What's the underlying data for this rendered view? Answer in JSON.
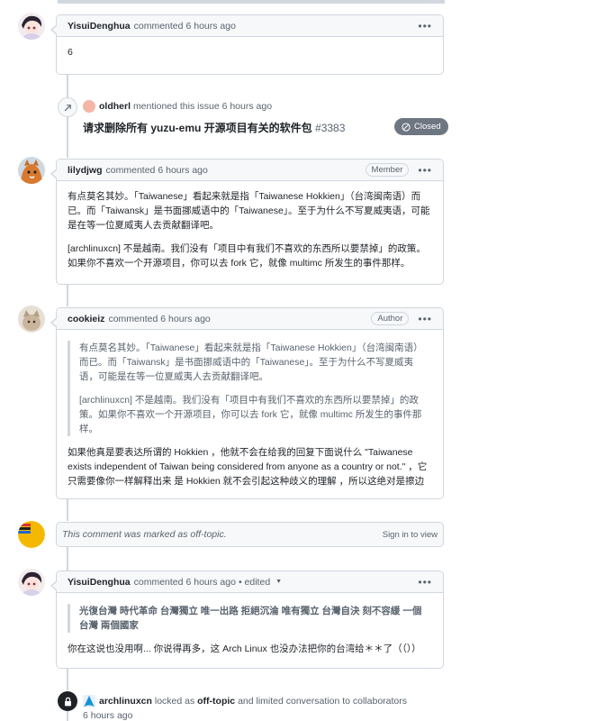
{
  "comments": [
    {
      "author": "YisuiDenghua",
      "action": "commented",
      "time": "6 hours ago",
      "paragraphs": [
        "6"
      ]
    },
    {
      "author": "lilydjwg",
      "action": "commented",
      "time": "6 hours ago",
      "badge": "Member",
      "paragraphs": [
        "有点莫名其妙。「Taiwanese」看起来就是指「Taiwanese Hokkien」（台湾闽南语）而已。而「Taiwansk」是书面挪威语中的「Taiwanese」。至于为什么不写夏威夷语，可能是在等一位夏威夷人去贡献翻译吧。",
        "[archlinuxcn] 不是越南。我们没有「项目中有我们不喜欢的东西所以要禁掉」的政策。如果你不喜欢一个开源项目，你可以去 fork 它，就像 multimc 所发生的事件那样。"
      ]
    },
    {
      "author": "cookieiz",
      "action": "commented",
      "time": "6 hours ago",
      "badge": "Author",
      "quote": [
        "有点莫名其妙。「Taiwanese」看起来就是指「Taiwanese Hokkien」（台湾闽南语）而已。而「Taiwansk」是书面挪威语中的「Taiwanese」。至于为什么不写夏威夷语，可能是在等一位夏威夷人去贡献翻译吧。",
        "[archlinuxcn] 不是越南。我们没有「项目中有我们不喜欢的东西所以要禁掉」的政策。如果你不喜欢一个开源项目，你可以去 fork 它，就像 multimc 所发生的事件那样。"
      ],
      "paragraphs": [
        "如果他真是要表达所谓的 Hokkien ，他就不会在给我的回复下面说什么 \"Taiwanese exists independent of Taiwan being considered from anyone as a country or not.\" ，它只需要像你一样解释出来 是 Hokkien 就不会引起这种歧义的理解 ，所以这绝对是擦边"
      ]
    },
    {
      "author": "YisuiDenghua",
      "action": "commented",
      "time": "6 hours ago",
      "edited": "• edited",
      "quote_bold": "光復台灣 時代革命 台灣獨立 唯一出路 拒絕沉淪 唯有獨立 台灣自決 刻不容緩 一個台灣 兩個國家",
      "paragraphs": [
        "你在这说也没用啊... 你说得再多，这 Arch Linux 也没办法把你的台湾给＊＊了（（））"
      ]
    }
  ],
  "mention_event": {
    "actor": "oldherl",
    "text": "mentioned this issue 6 hours ago",
    "issue_title": "请求删除所有 yuzu-emu 开源项目有关的软件包",
    "issue_number": "#3383",
    "status": "Closed"
  },
  "offtopic": {
    "text": "This comment was marked as off-topic.",
    "action": "Sign in to view"
  },
  "lock_event": {
    "actor": "archlinuxcn",
    "text1": "locked as",
    "reason": "off-topic",
    "text2": "and limited conversation to collaborators",
    "time": "6 hours ago"
  },
  "colors": {
    "border": "#d0d7de",
    "header_bg": "#f6f8fa",
    "closed": "#6e7781",
    "text": "#1f2328",
    "muted": "#59636e"
  },
  "icons": {
    "kebab": "kebab-menu-icon",
    "cross_reference": "cross-reference-icon",
    "closed": "issue-closed-icon",
    "lock": "lock-icon"
  }
}
